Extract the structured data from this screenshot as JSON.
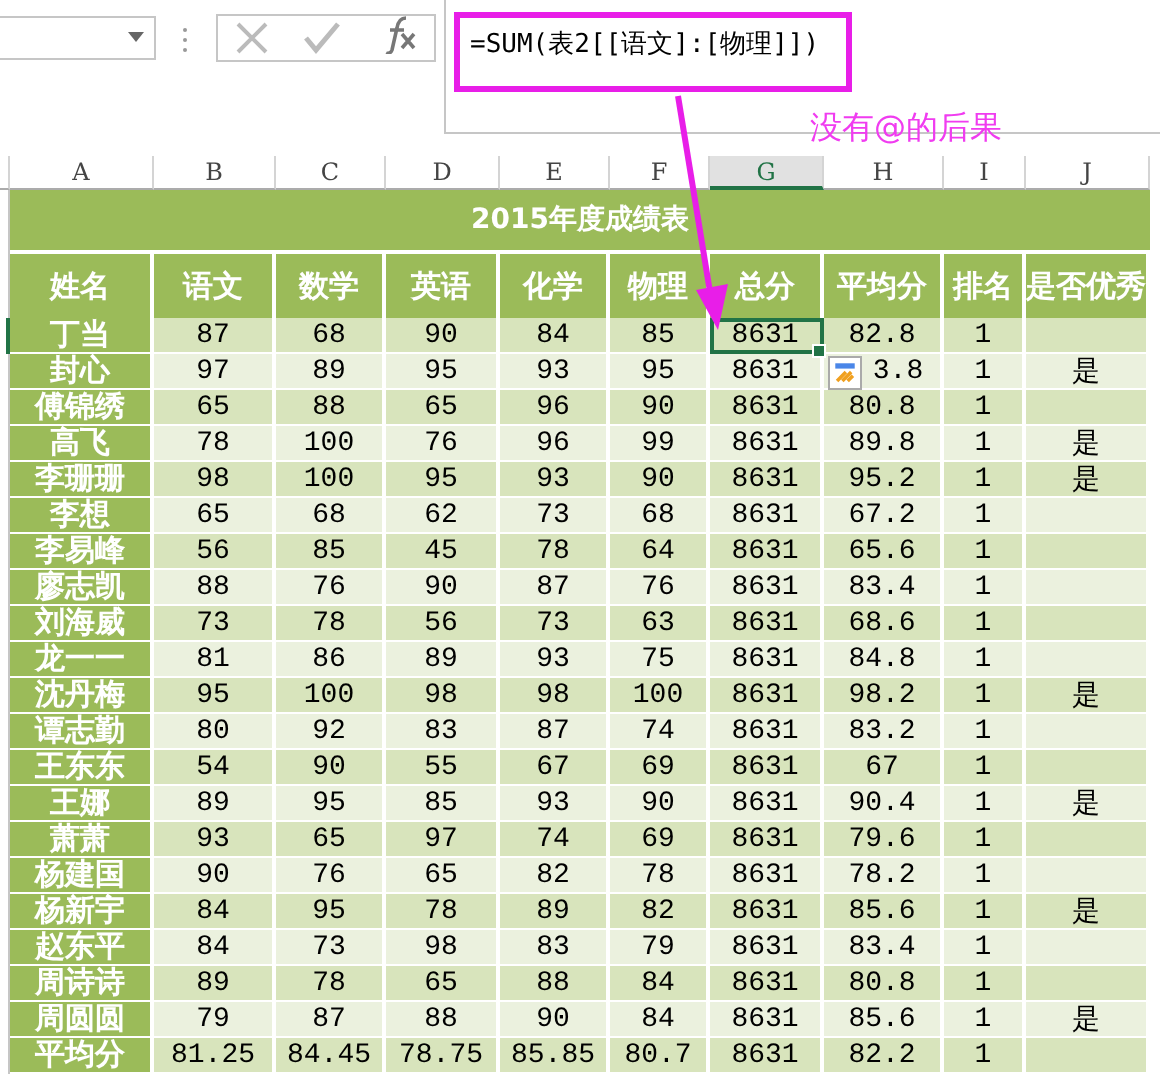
{
  "formula_bar": {
    "formula": "=SUM(表2[[语文]:[物理]])"
  },
  "annotation": "没有@的后果",
  "column_headers": [
    {
      "label": "A",
      "selected": false
    },
    {
      "label": "B",
      "selected": false
    },
    {
      "label": "C",
      "selected": false
    },
    {
      "label": "D",
      "selected": false
    },
    {
      "label": "E",
      "selected": false
    },
    {
      "label": "F",
      "selected": false
    },
    {
      "label": "G",
      "selected": true
    },
    {
      "label": "H",
      "selected": false
    },
    {
      "label": "I",
      "selected": false
    },
    {
      "label": "J",
      "selected": false
    }
  ],
  "table": {
    "title": "2015年度成绩表",
    "columns": [
      "姓名",
      "语文",
      "数学",
      "英语",
      "化学",
      "物理",
      "总分",
      "平均分",
      "排名",
      "是否优秀"
    ],
    "rows": [
      {
        "cells": [
          "丁当",
          "87",
          "68",
          "90",
          "84",
          "85",
          "8631",
          "82.8",
          "1"
        ],
        "selected": true,
        "paste_options": false
      },
      {
        "cells": [
          "封心",
          "97",
          "89",
          "95",
          "93",
          "95",
          "8631",
          "3.8",
          "1"
        ],
        "excellent": "是",
        "selected": false,
        "paste_options": true
      },
      {
        "cells": [
          "傅锦绣",
          "65",
          "88",
          "65",
          "96",
          "90",
          "8631",
          "80.8",
          "1"
        ],
        "selected": false,
        "paste_options": false
      },
      {
        "cells": [
          "高飞",
          "78",
          "100",
          "76",
          "96",
          "99",
          "8631",
          "89.8",
          "1"
        ],
        "excellent": "是",
        "selected": false,
        "paste_options": false
      },
      {
        "cells": [
          "李珊珊",
          "98",
          "100",
          "95",
          "93",
          "90",
          "8631",
          "95.2",
          "1"
        ],
        "excellent": "是",
        "selected": false,
        "paste_options": false
      },
      {
        "cells": [
          "李想",
          "65",
          "68",
          "62",
          "73",
          "68",
          "8631",
          "67.2",
          "1"
        ],
        "selected": false,
        "paste_options": false
      },
      {
        "cells": [
          "李易峰",
          "56",
          "85",
          "45",
          "78",
          "64",
          "8631",
          "65.6",
          "1"
        ],
        "selected": false,
        "paste_options": false
      },
      {
        "cells": [
          "廖志凯",
          "88",
          "76",
          "90",
          "87",
          "76",
          "8631",
          "83.4",
          "1"
        ],
        "selected": false,
        "paste_options": false
      },
      {
        "cells": [
          "刘海威",
          "73",
          "78",
          "56",
          "73",
          "63",
          "8631",
          "68.6",
          "1"
        ],
        "selected": false,
        "paste_options": false
      },
      {
        "cells": [
          "龙一一",
          "81",
          "86",
          "89",
          "93",
          "75",
          "8631",
          "84.8",
          "1"
        ],
        "selected": false,
        "paste_options": false
      },
      {
        "cells": [
          "沈丹梅",
          "95",
          "100",
          "98",
          "98",
          "100",
          "8631",
          "98.2",
          "1"
        ],
        "excellent": "是",
        "selected": false,
        "paste_options": false
      },
      {
        "cells": [
          "谭志勤",
          "80",
          "92",
          "83",
          "87",
          "74",
          "8631",
          "83.2",
          "1"
        ],
        "selected": false,
        "paste_options": false
      },
      {
        "cells": [
          "王东东",
          "54",
          "90",
          "55",
          "67",
          "69",
          "8631",
          "67",
          "1"
        ],
        "selected": false,
        "paste_options": false
      },
      {
        "cells": [
          "王娜",
          "89",
          "95",
          "85",
          "93",
          "90",
          "8631",
          "90.4",
          "1"
        ],
        "excellent": "是",
        "selected": false,
        "paste_options": false
      },
      {
        "cells": [
          "萧萧",
          "93",
          "65",
          "97",
          "74",
          "69",
          "8631",
          "79.6",
          "1"
        ],
        "selected": false,
        "paste_options": false
      },
      {
        "cells": [
          "杨建国",
          "90",
          "76",
          "65",
          "82",
          "78",
          "8631",
          "78.2",
          "1"
        ],
        "selected": false,
        "paste_options": false
      },
      {
        "cells": [
          "杨新宇",
          "84",
          "95",
          "78",
          "89",
          "82",
          "8631",
          "85.6",
          "1"
        ],
        "excellent": "是",
        "selected": false,
        "paste_options": false
      },
      {
        "cells": [
          "赵东平",
          "84",
          "73",
          "98",
          "83",
          "79",
          "8631",
          "83.4",
          "1"
        ],
        "selected": false,
        "paste_options": false
      },
      {
        "cells": [
          "周诗诗",
          "89",
          "78",
          "65",
          "88",
          "84",
          "8631",
          "80.8",
          "1"
        ],
        "selected": false,
        "paste_options": false
      },
      {
        "cells": [
          "周圆圆",
          "79",
          "87",
          "88",
          "90",
          "84",
          "8631",
          "85.6",
          "1"
        ],
        "excellent": "是",
        "selected": false,
        "paste_options": false
      },
      {
        "cells": [
          "平均分",
          "81.25",
          "84.45",
          "78.75",
          "85.85",
          "80.7",
          "8631",
          "82.2",
          "1"
        ],
        "selected": false,
        "paste_options": false
      }
    ]
  }
}
